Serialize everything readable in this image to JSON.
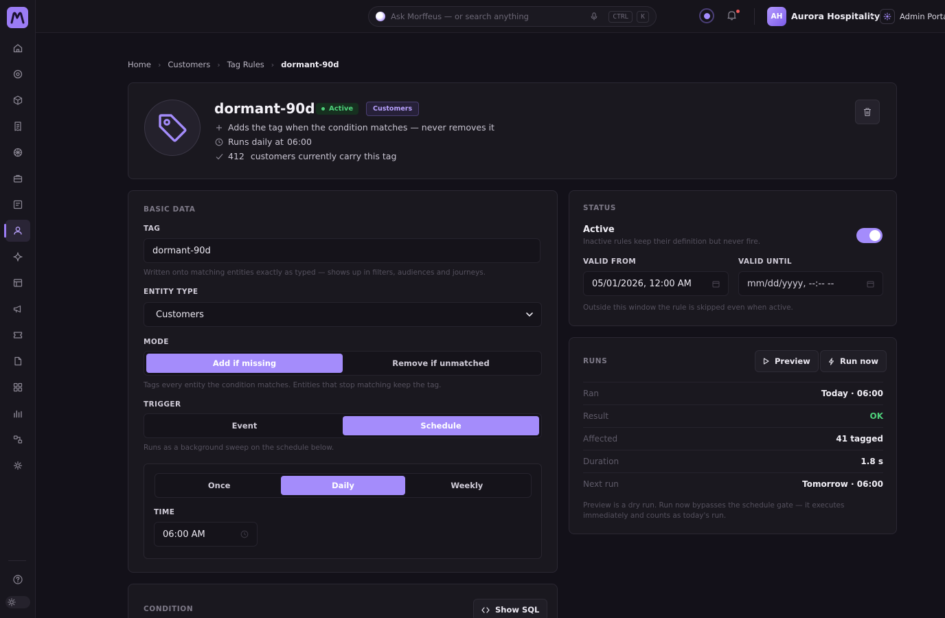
{
  "topbar": {
    "search_placeholder": "Ask Morffeus — or search anything",
    "kbd_ctrl": "CTRL",
    "kbd_k": "K",
    "org_initials": "AH",
    "org_name": "Aurora Hospitality",
    "portal_name": "Admin Portal"
  },
  "breadcrumb": [
    "Home",
    "Customers",
    "Tag Rules",
    "dormant-90d"
  ],
  "header": {
    "title": "dormant-90d",
    "status_badge": "Active",
    "entity_badge": "Customers",
    "line1": "Adds the tag when the condition matches — never removes it",
    "line2_prefix": "Runs daily at",
    "line2_time": "06:00",
    "line3_count": "412",
    "line3_text": "customers currently carry this tag"
  },
  "basic": {
    "section_title": "BASIC DATA",
    "tag_label": "TAG",
    "tag_value": "dormant-90d",
    "tag_help": "Written onto matching entities exactly as typed — shows up in filters, audiences and journeys.",
    "entity_label": "ENTITY TYPE",
    "entity_value": "Customers",
    "mode_label": "MODE",
    "mode_options": [
      "Add if missing",
      "Remove if unmatched"
    ],
    "mode_help": "Tags every entity the condition matches. Entities that stop matching keep the tag.",
    "trigger_label": "TRIGGER",
    "trigger_options": [
      "Event",
      "Schedule"
    ],
    "trigger_help": "Runs as a background sweep on the schedule below.",
    "frequency_options": [
      "Once",
      "Daily",
      "Weekly"
    ],
    "time_label": "TIME",
    "time_value": "06:00 AM"
  },
  "status": {
    "section_title": "STATUS",
    "active_label": "Active",
    "active_help": "Inactive rules keep their definition but never fire.",
    "valid_from_label": "VALID FROM",
    "valid_from_value": "05/01/2026, 12:00 AM",
    "valid_until_label": "VALID UNTIL",
    "valid_until_value": "mm/dd/yyyy, --:-- --",
    "window_help": "Outside this window the rule is skipped even when active."
  },
  "runs": {
    "section_title": "RUNS",
    "preview_label": "Preview",
    "run_now_label": "Run now",
    "rows": [
      {
        "key": "Ran",
        "value": "Today · 06:00"
      },
      {
        "key": "Result",
        "value": "OK"
      },
      {
        "key": "Affected",
        "value": "41 tagged"
      },
      {
        "key": "Duration",
        "value": "1.8 s"
      },
      {
        "key": "Next run",
        "value": "Tomorrow · 06:00"
      }
    ],
    "help_line1": "Preview is a dry run. Run now bypasses the schedule gate — it executes",
    "help_line2": "immediately and counts as today's run."
  },
  "condition": {
    "section_title": "CONDITION",
    "show_sql_label": "Show SQL"
  },
  "colors": {
    "accent": "#a48cfb",
    "success": "#4ed07a",
    "background": "#131119",
    "card": "#1a181f"
  },
  "icons": {
    "sidebar": [
      "home-icon",
      "target-icon",
      "box-icon",
      "receipt-icon",
      "globe-icon",
      "briefcase-icon",
      "form-icon",
      "user-icon",
      "sparkle-icon",
      "table-icon",
      "megaphone-icon",
      "ticket-icon",
      "document-icon",
      "grid-icon",
      "bar-chart-icon",
      "flow-icon",
      "settings-icon",
      "help-icon",
      "sun-icon"
    ]
  }
}
